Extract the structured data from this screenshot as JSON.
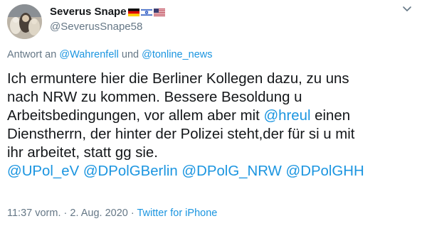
{
  "author": {
    "display_name": "Severus Snape",
    "handle": "@SeverusSnape58",
    "flags": [
      "flag-germany-icon",
      "flag-israel-icon",
      "flag-usa-icon"
    ]
  },
  "reply_to": {
    "prefix": "Antwort an",
    "mention1": "@Wahrenfell",
    "conjunction": "und",
    "mention2": "@tonline_news"
  },
  "tweet": {
    "line1": "Ich ermuntere hier die Berliner Kollegen dazu, zu uns",
    "line2": "nach NRW zu kommen. Bessere Besoldung u",
    "line3": "Arbeitsbedingungen, vor allem aber mit",
    "mention_hreul": "@hreul",
    "line4_after": "einen",
    "line5": "Dienstherrn, der hinter der Polizei steht,der für si u mit",
    "line6": "ihr arbeitet, statt gg sie.",
    "mentions": [
      "@UPol_eV",
      "@DPolGBerlin",
      "@DPolG_NRW",
      "@DPolGHH"
    ]
  },
  "meta": {
    "time": "11:37 vorm.",
    "separator": "·",
    "date": "2. Aug. 2020",
    "source": "Twitter for iPhone"
  },
  "colors": {
    "link": "#1b95e0",
    "secondary_text": "#657786",
    "primary_text": "#14171a"
  }
}
